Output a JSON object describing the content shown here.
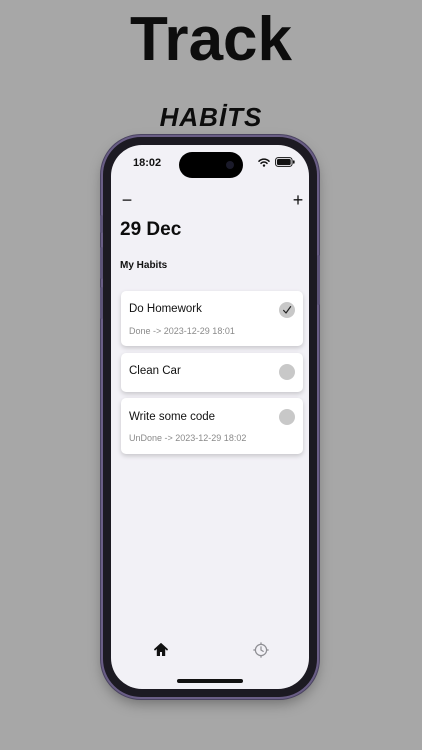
{
  "headline": "Track",
  "subheadline": "HABİTS",
  "status_bar": {
    "time": "18:02"
  },
  "toolbar": {
    "remove_label": "−",
    "add_label": "+"
  },
  "date_title": "29 Dec",
  "section_title": "My Habits",
  "habits": [
    {
      "title": "Do Homework",
      "subtitle": "Done -> 2023-12-29 18:01",
      "done": true
    },
    {
      "title": "Clean Car",
      "subtitle": "",
      "done": false
    },
    {
      "title": "Write some code",
      "subtitle": "UnDone -> 2023-12-29 18:02",
      "done": false
    }
  ],
  "tab_bar": [
    {
      "icon": "house-icon",
      "active": true
    },
    {
      "icon": "clock-gear-icon",
      "active": false
    }
  ],
  "colors": {
    "background": "#a7a7a7",
    "screen": "#f2f1f6",
    "phone_frame": "#1c1a22",
    "check_circle": "#c8c8c8"
  }
}
